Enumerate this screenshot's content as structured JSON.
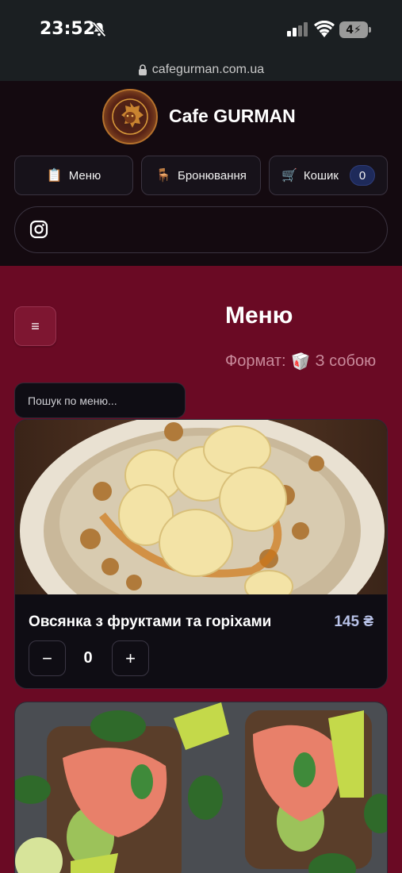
{
  "status_bar": {
    "time": "23:52",
    "battery": "4"
  },
  "browser": {
    "url": "cafegurman.com.ua"
  },
  "header": {
    "brand": "Cafe GURMAN",
    "nav": {
      "menu": {
        "icon": "📋",
        "label": "Меню"
      },
      "booking": {
        "icon": "🪑",
        "label": "Бронювання"
      },
      "cart": {
        "icon": "🛒",
        "label": "Кошик",
        "count": "0"
      }
    }
  },
  "menu_section": {
    "hamburger": "≡",
    "title": "Меню",
    "format_label": "Формат:",
    "format_icon": "🥡",
    "format_value": "З собою",
    "search_placeholder": "Пошук по меню..."
  },
  "items": [
    {
      "name": "Овсянка з фруктами та горіхами",
      "price": "145 ₴",
      "qty": "0",
      "minus": "−",
      "plus": "+"
    }
  ]
}
